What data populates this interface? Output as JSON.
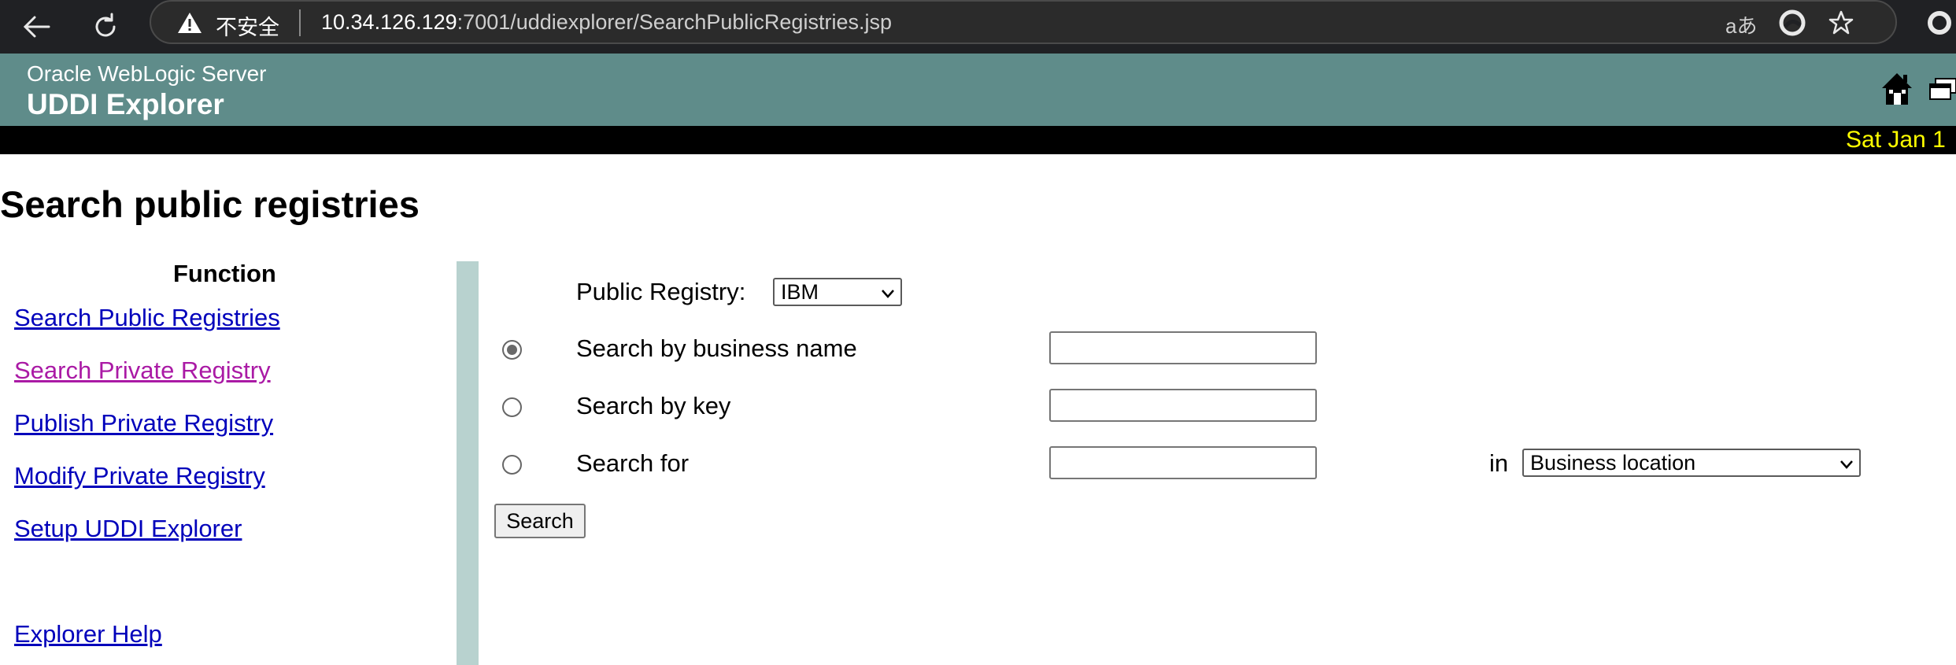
{
  "browser": {
    "security_label": "不安全",
    "url_host": "10.34.126.129",
    "url_rest": ":7001/uddiexplorer/SearchPublicRegistries.jsp",
    "reader_label": "aあ"
  },
  "header": {
    "product_name": "Oracle WebLogic Server",
    "app_name": "UDDI Explorer",
    "date_text": "Sat Jan 1",
    "colors": {
      "header_bg": "#5f8c8a",
      "date_bar_bg": "#000000",
      "date_text": "#ffff00"
    }
  },
  "page": {
    "title": "Search public registries"
  },
  "sidebar": {
    "heading": "Function",
    "links": [
      {
        "label": "Search Public Registries",
        "visited": false
      },
      {
        "label": "Search Private Registry",
        "visited": true
      },
      {
        "label": "Publish Private Registry",
        "visited": false
      },
      {
        "label": "Modify Private Registry",
        "visited": false
      },
      {
        "label": "Setup UDDI Explorer",
        "visited": false
      }
    ],
    "help_link": "Explorer Help"
  },
  "form": {
    "registry_label": "Public Registry:",
    "registry_value": "IBM",
    "options": [
      {
        "label": "Search by business name",
        "selected": true,
        "value": ""
      },
      {
        "label": "Search by key",
        "selected": false,
        "value": ""
      },
      {
        "label": "Search for",
        "selected": false,
        "value": ""
      }
    ],
    "in_label": "in",
    "in_value": "Business location",
    "search_button": "Search"
  }
}
